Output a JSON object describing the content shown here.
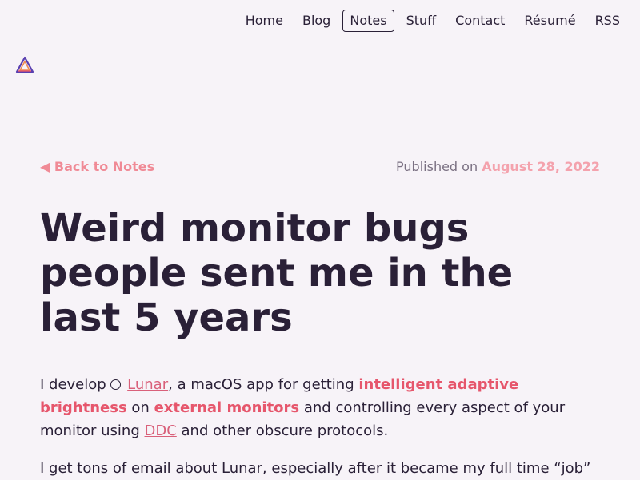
{
  "nav": {
    "items": [
      {
        "label": "Home",
        "name": "nav-home"
      },
      {
        "label": "Blog",
        "name": "nav-blog"
      },
      {
        "label": "Notes",
        "name": "nav-notes",
        "active": true
      },
      {
        "label": "Stuff",
        "name": "nav-stuff"
      },
      {
        "label": "Contact",
        "name": "nav-contact"
      },
      {
        "label": "Résumé",
        "name": "nav-resume"
      },
      {
        "label": "RSS",
        "name": "nav-rss"
      }
    ]
  },
  "logo": {
    "icon": "triangle-logo-icon"
  },
  "article": {
    "back_label": "◀ Back to Notes",
    "published_prefix": "Published on ",
    "published_date": "August 28, 2022",
    "title": "Weird monitor bugs people sent me in the last 5 years",
    "p1": {
      "t1": "I develop ",
      "lunar_link": "Lunar",
      "t2": ", a macOS app for getting ",
      "hl1": "intelligent adaptive brightness",
      "t3": " on ",
      "hl2": "external monitors",
      "t4": " and controlling every aspect of your monitor using ",
      "ddc_link": "DDC",
      "t5": " and other obscure protocols."
    },
    "p2": "I get tons of email about Lunar, especially after it became my full time “job”"
  },
  "colors": {
    "background": "#f7f3f8",
    "text": "#2a2037",
    "accent": "#e6566c",
    "link": "#d9607a"
  }
}
